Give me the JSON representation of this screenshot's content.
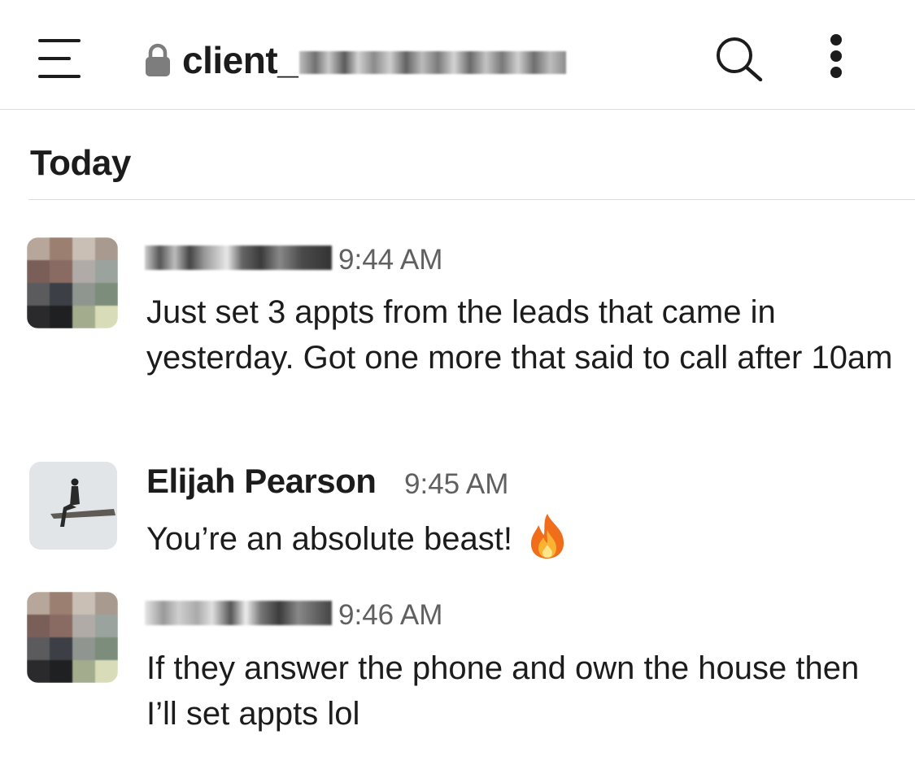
{
  "header": {
    "channel_prefix": "client_",
    "channel_redacted": true,
    "icons": {
      "menu": "hamburger-menu-icon",
      "lock": "lock-icon",
      "search": "search-icon",
      "more": "more-vertical-icon"
    }
  },
  "day_divider": {
    "label": "Today"
  },
  "messages": [
    {
      "sender_redacted": true,
      "avatar": "pixelated-avatar",
      "time": "9:44 AM",
      "text": "Just set 3 appts from the leads that came in yesterday. Got one more that said to call after 10am"
    },
    {
      "sender": "Elijah Pearson",
      "avatar": "person-sitting-avatar",
      "time": "9:45 AM",
      "text": "You’re an absolute beast!",
      "emoji": "fire-icon"
    },
    {
      "sender_redacted": true,
      "avatar": "pixelated-avatar",
      "time": "9:46 AM",
      "text": "If they answer the phone and own the house then I’ll set appts lol"
    }
  ],
  "colors": {
    "text_primary": "#1d1c1d",
    "text_secondary": "#616061",
    "divider": "#dddddd"
  }
}
